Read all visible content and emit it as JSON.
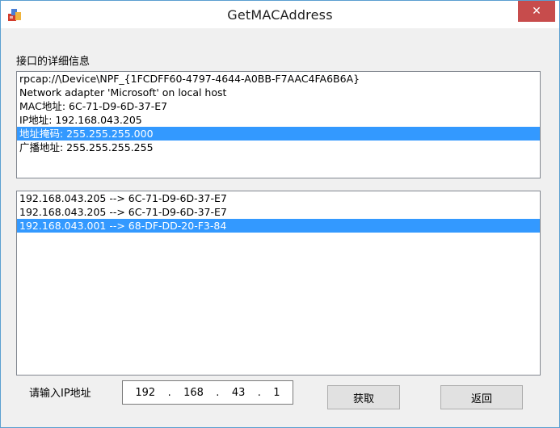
{
  "window": {
    "title": "GetMACAddress",
    "close_label": "✕"
  },
  "details_label": "接口的详细信息",
  "details": [
    "rpcap://\\Device\\NPF_{1FCDFF60-4797-4644-A0BB-F7AAC4FA6B6A}",
    "Network adapter 'Microsoft' on local host",
    "MAC地址:  6C-71-D9-6D-37-E7",
    "IP地址:  192.168.043.205",
    "地址掩码: 255.255.255.000",
    "广播地址: 255.255.255.255"
  ],
  "details_selected_index": 4,
  "results": [
    "192.168.043.205 --> 6C-71-D9-6D-37-E7",
    "192.168.043.205 --> 6C-71-D9-6D-37-E7",
    "192.168.043.001 --> 68-DF-DD-20-F3-84"
  ],
  "results_selected_index": 2,
  "ip_input": {
    "label": "请输入IP地址",
    "octets": [
      "192",
      "168",
      "43",
      "1"
    ],
    "separator": "."
  },
  "buttons": {
    "get": "获取",
    "back": "返回"
  }
}
